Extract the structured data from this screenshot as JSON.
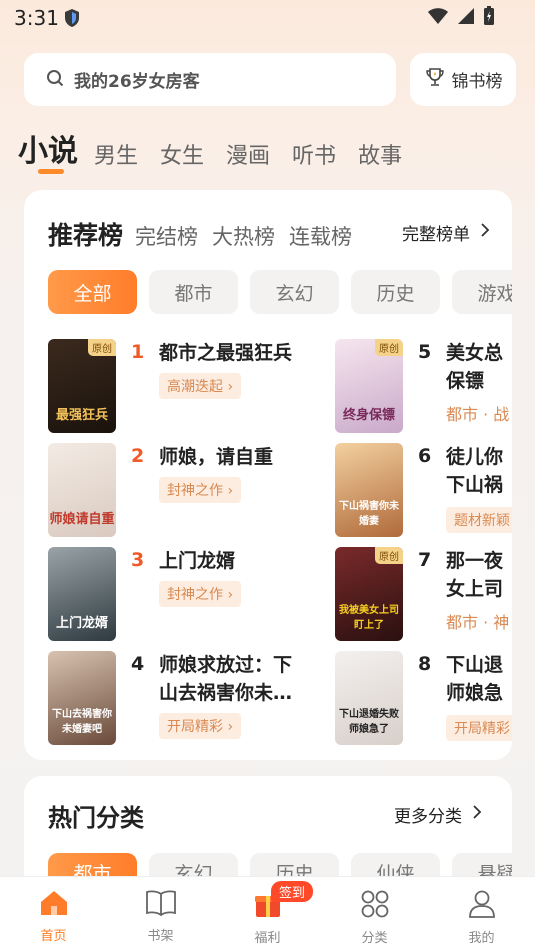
{
  "status": {
    "time": "3:31"
  },
  "search": {
    "placeholder": "我的26岁女房客",
    "rank_button": "锦书榜"
  },
  "categories": [
    "小说",
    "男生",
    "女生",
    "漫画",
    "听书",
    "故事"
  ],
  "ranking": {
    "tabs": [
      "推荐榜",
      "完结榜",
      "大热榜",
      "连载榜"
    ],
    "full_list": "完整榜单",
    "genres": [
      "全部",
      "都市",
      "玄幻",
      "历史",
      "游戏"
    ],
    "books": [
      {
        "rank": "1",
        "title": "都市之最强狂兵",
        "tag": "高潮迭起",
        "cover_text": "最强狂兵",
        "original": "原创"
      },
      {
        "rank": "2",
        "title": "师娘，请自重",
        "tag": "封神之作",
        "cover_text": "师娘请自重"
      },
      {
        "rank": "3",
        "title": "上门龙婿",
        "tag": "封神之作",
        "cover_text": "上门龙婿"
      },
      {
        "rank": "4",
        "title": "师娘求放过：下山去祸害你未…",
        "tag": "开局精彩",
        "cover_text": "下山去祸害你未婚妻吧"
      },
      {
        "rank": "5",
        "title": "美女总裁的贴身保镖",
        "title_l1": "美女总",
        "title_l2": "保镖",
        "meta": "都市 · 战",
        "cover_text": "终身保镖",
        "original": "原创"
      },
      {
        "rank": "6",
        "title": "徒儿你无敌了下山祸害你未婚妻",
        "title_l1": "徒儿你",
        "title_l2": "下山祸",
        "tag": "题材新颖",
        "cover_text": "下山祸害你未婚妻"
      },
      {
        "rank": "7",
        "title": "那一夜女上司",
        "title_l1": "那一夜",
        "title_l2": "女上司",
        "meta": "都市 · 神",
        "cover_text": "我被美女上司盯上了",
        "original": "原创"
      },
      {
        "rank": "8",
        "title": "下山退婚师娘急了",
        "title_l1": "下山退",
        "title_l2": "师娘急",
        "tag": "开局精彩",
        "cover_text": "下山退婚失败 师娘急了"
      }
    ]
  },
  "hot": {
    "title": "热门分类",
    "more": "更多分类",
    "genres": [
      "都市",
      "玄幻",
      "历史",
      "仙侠",
      "悬疑"
    ]
  },
  "nav": {
    "items": [
      "首页",
      "书架",
      "福利",
      "分类",
      "我的"
    ],
    "badge": "签到"
  },
  "colors": {
    "accent": "#ff7d2a",
    "rank_hot": "#f05a28"
  }
}
